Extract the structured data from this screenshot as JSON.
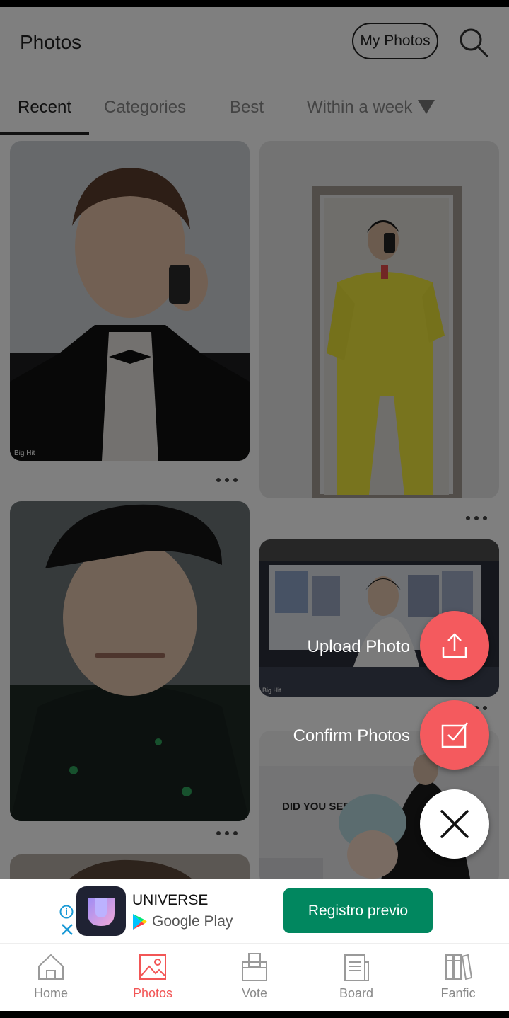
{
  "header": {
    "title": "Photos",
    "my_photos_label": "My Photos",
    "search_icon": "search-icon"
  },
  "tabs": [
    {
      "label": "Recent",
      "active": true
    },
    {
      "label": "Categories",
      "active": false
    },
    {
      "label": "Best",
      "active": false
    },
    {
      "label": "Within a week",
      "active": false
    }
  ],
  "photos": [
    {
      "name": "photo-1",
      "description_icon": "image"
    },
    {
      "name": "photo-2",
      "description_icon": "image"
    },
    {
      "name": "photo-3",
      "description_icon": "image"
    },
    {
      "name": "photo-4",
      "description_icon": "image"
    },
    {
      "name": "photo-5",
      "description_icon": "image"
    },
    {
      "name": "photo-6",
      "description_icon": "image"
    }
  ],
  "photo_text": {
    "watermark": "Big Hit",
    "sign_text": "DID YOU SEE MY B"
  },
  "fab_menu": {
    "upload_label": "Upload Photo",
    "confirm_label": "Confirm Photos",
    "accent_color": "#f45a5e"
  },
  "ad": {
    "app_name": "UNIVERSE",
    "store_label": "Google Play",
    "cta_label": "Registro previo",
    "cta_color": "#01875f"
  },
  "bottom_nav": [
    {
      "label": "Home",
      "icon": "home-icon",
      "active": false
    },
    {
      "label": "Photos",
      "icon": "photos-icon",
      "active": true
    },
    {
      "label": "Vote",
      "icon": "vote-icon",
      "active": false
    },
    {
      "label": "Board",
      "icon": "board-icon",
      "active": false
    },
    {
      "label": "Fanfic",
      "icon": "fanfic-icon",
      "active": false
    }
  ],
  "colors": {
    "active_nav": "#f25656",
    "inactive_nav": "#8a8a8a"
  }
}
